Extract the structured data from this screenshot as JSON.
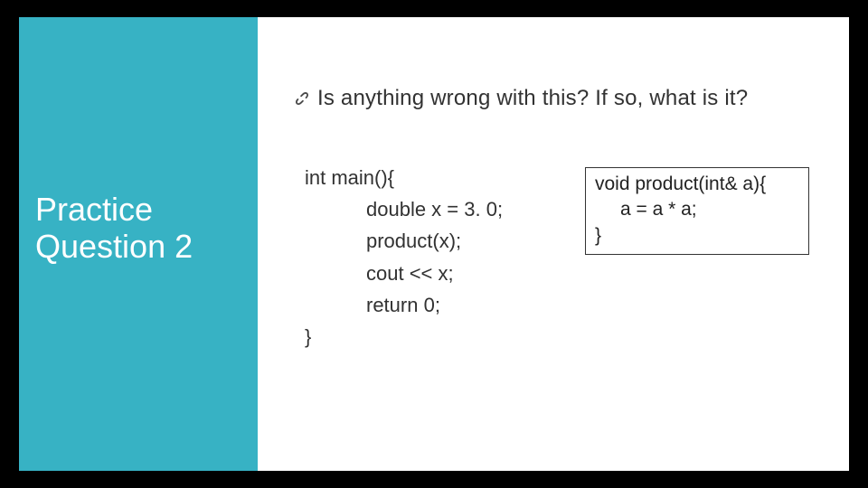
{
  "sidebar": {
    "title_line1": "Practice",
    "title_line2": "Question 2"
  },
  "bullet": {
    "text": "Is anything wrong with this? If so, what is it?"
  },
  "main_code": {
    "l1": "int main(){",
    "l2": "double x = 3. 0;",
    "l3": "product(x);",
    "l4": "cout << x;",
    "l5": "return 0;",
    "l6": "}"
  },
  "box_code": {
    "l1": "void product(int& a){",
    "l2": "a = a * a;",
    "l3": "}"
  }
}
